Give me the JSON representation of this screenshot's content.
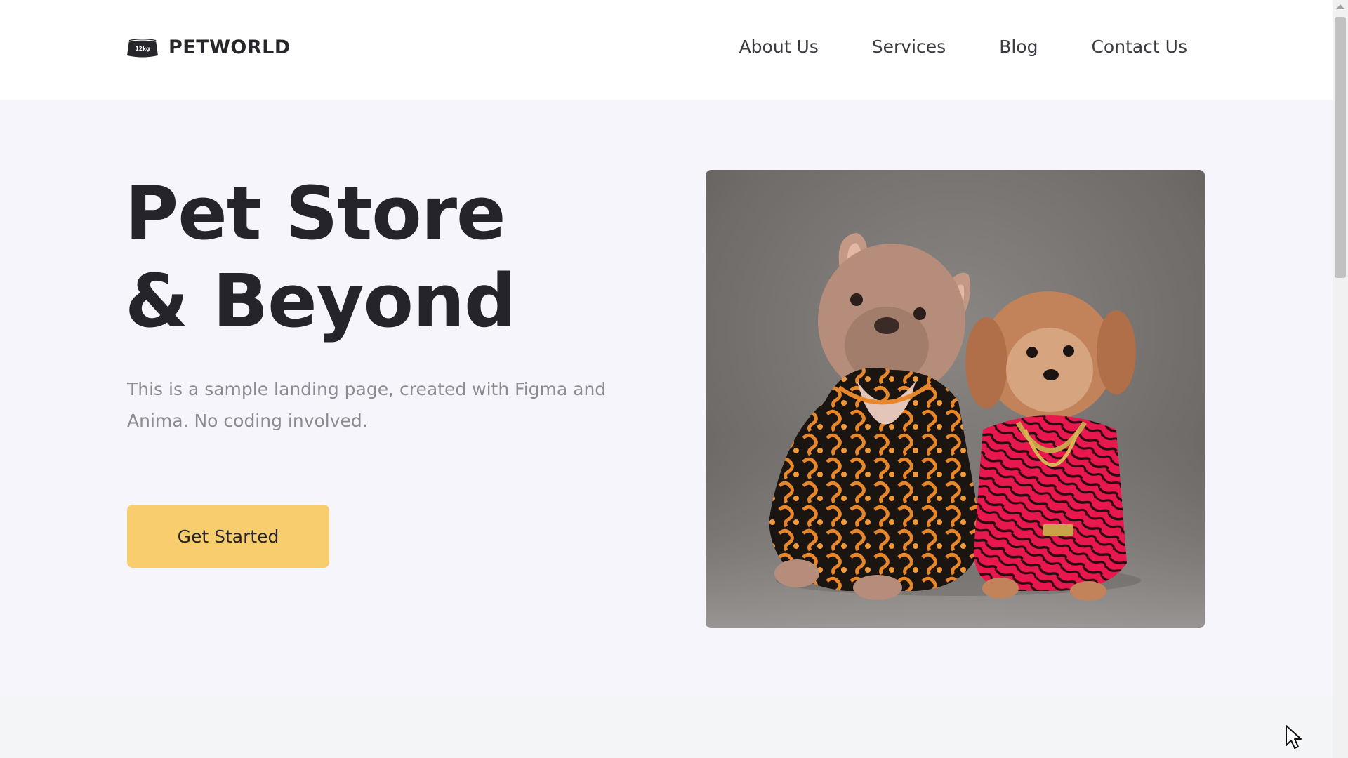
{
  "brand": {
    "name": "PETWORLD",
    "logo_icon_text": "12kg",
    "logo_icon": "pet-food-bag-icon"
  },
  "nav": {
    "items": [
      {
        "label": "About Us"
      },
      {
        "label": "Services"
      },
      {
        "label": "Blog"
      },
      {
        "label": "Contact Us"
      }
    ]
  },
  "hero": {
    "title_line1": "Pet Store",
    "title_line2": "& Beyond",
    "subtitle": "This is a sample landing page, created with Figma and Anima. No coding involved.",
    "cta_label": "Get Started",
    "image_alt": "Two dogs wearing patterned jackets",
    "image_icon": "dogs-photo"
  },
  "colors": {
    "cta_background": "#f7cd6e",
    "hero_background": "#f6f5fb",
    "title_text": "#24242a",
    "subtitle_text": "#8b8b92",
    "jacket_orange": "#e8862a",
    "jacket_pink": "#e8184f"
  }
}
